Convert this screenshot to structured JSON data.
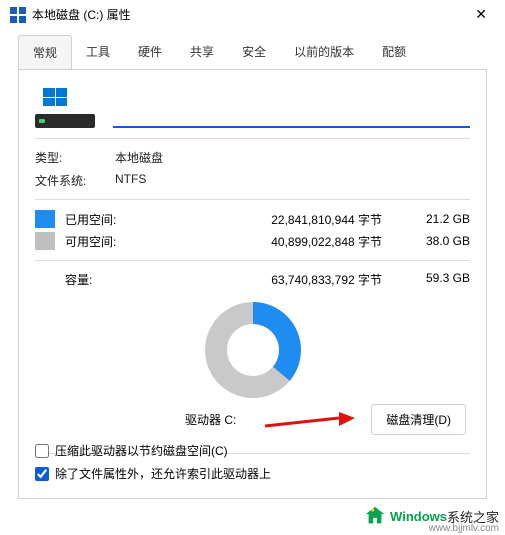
{
  "titlebar": {
    "title": "本地磁盘 (C:) 属性"
  },
  "tabs": {
    "items": [
      "常规",
      "工具",
      "硬件",
      "共享",
      "安全",
      "以前的版本",
      "配额"
    ],
    "active_index": 0
  },
  "general": {
    "name_value": "",
    "name_placeholder": "",
    "type_label": "类型:",
    "type_value": "本地磁盘",
    "fs_label": "文件系统:",
    "fs_value": "NTFS",
    "used_label": "已用空间:",
    "used_bytes": "22,841,810,944 字节",
    "used_gb": "21.2 GB",
    "free_label": "可用空间:",
    "free_bytes": "40,899,022,848 字节",
    "free_gb": "38.0 GB",
    "capacity_label": "容量:",
    "capacity_bytes": "63,740,833,792 字节",
    "capacity_gb": "59.3 GB",
    "drive_label": "驱动器 C:",
    "cleanup_button": "磁盘清理(D)",
    "compress_label": "压缩此驱动器以节约磁盘空间(C)",
    "index_label": "除了文件属性外，还允许索引此驱动器上"
  },
  "chart_data": {
    "type": "pie",
    "title": "",
    "series": [
      {
        "name": "已用空间",
        "value": 21.2,
        "color": "#1e8cf0"
      },
      {
        "name": "可用空间",
        "value": 38.0,
        "color": "#c9c9c9"
      }
    ],
    "unit": "GB",
    "total": 59.3
  },
  "watermark": {
    "brand1": "Windows",
    "brand2": "系统之家",
    "url": "www.bjjmlv.com"
  }
}
